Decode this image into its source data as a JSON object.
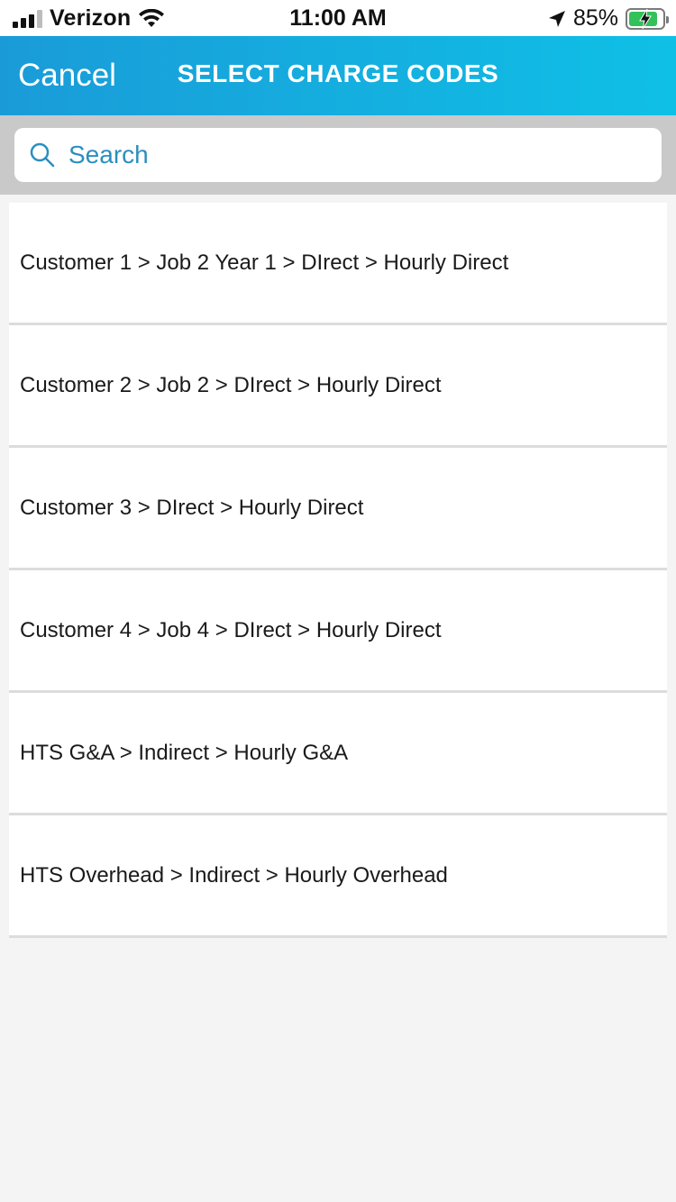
{
  "status_bar": {
    "carrier": "Verizon",
    "time": "11:00 AM",
    "battery": "85%",
    "battery_level": 0.85,
    "icons": [
      "signal-icon",
      "wifi-icon",
      "location-arrow-icon",
      "battery-charging-icon"
    ]
  },
  "nav": {
    "cancel_label": "Cancel",
    "title": "SELECT CHARGE CODES",
    "colors": {
      "gradient_start": "#1a9bd8",
      "gradient_end": "#0fc0e6"
    }
  },
  "search": {
    "placeholder": "Search",
    "value": ""
  },
  "charge_codes": [
    "Customer 1 > Job 2 Year 1 > DIrect > Hourly Direct",
    "Customer 2 > Job 2 > DIrect > Hourly Direct",
    "Customer 3 > DIrect > Hourly Direct",
    "Customer 4 > Job 4 > DIrect > Hourly Direct",
    "HTS G&A > Indirect > Hourly G&A",
    "HTS Overhead > Indirect > Hourly Overhead"
  ]
}
